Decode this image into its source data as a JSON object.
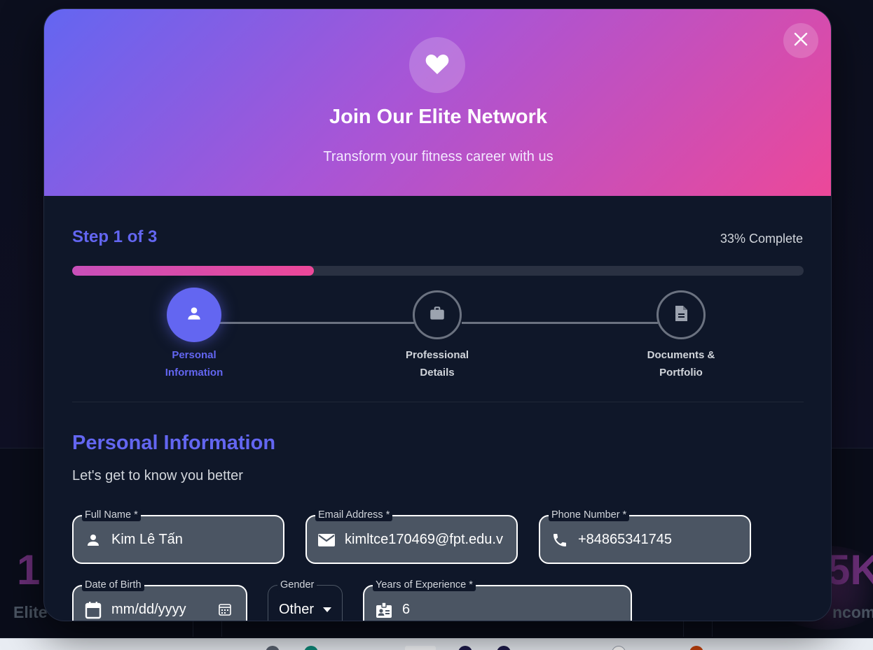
{
  "modal": {
    "title": "Join Our Elite Network",
    "subtitle": "Transform your fitness career with us",
    "close_icon": "close-icon",
    "header_icon": "heart-icon"
  },
  "progress": {
    "step_text": "Step 1 of 3",
    "percent_text": "33% Complete",
    "fraction": 0.33
  },
  "steps": [
    {
      "label_line1": "Personal",
      "label_line2": "Information",
      "icon": "person-icon",
      "active": true
    },
    {
      "label_line1": "Professional",
      "label_line2": "Details",
      "icon": "briefcase-icon",
      "active": false
    },
    {
      "label_line1": "Documents &",
      "label_line2": "Portfolio",
      "icon": "document-icon",
      "active": false
    }
  ],
  "section": {
    "title": "Personal Information",
    "subtitle": "Let's get to know you better"
  },
  "form": {
    "full_name": {
      "label": "Full Name *",
      "value": "Kim Lê Tấn",
      "icon": "person-icon"
    },
    "email": {
      "label": "Email Address *",
      "value": "kimltce170469@fpt.edu.v",
      "icon": "mail-icon"
    },
    "phone": {
      "label": "Phone Number *",
      "value": "+84865341745",
      "icon": "phone-icon"
    },
    "dob": {
      "label": "Date of Birth",
      "placeholder": "mm/dd/yyyy",
      "icon": "calendar-icon"
    },
    "gender": {
      "label": "Gender",
      "value": "Other"
    },
    "experience": {
      "label": "Years of Experience *",
      "value": "6",
      "icon": "badge-icon"
    }
  },
  "background": {
    "stat_left_fragment": "1",
    "stat_right_fragment": "5K",
    "label_left_fragment": "Elite",
    "label_right_fragment": "ncom"
  },
  "colors": {
    "accent": "#6366f1",
    "pink": "#ec4899",
    "field_bg": "#4b5563",
    "modal_bg": "#0f1729"
  }
}
